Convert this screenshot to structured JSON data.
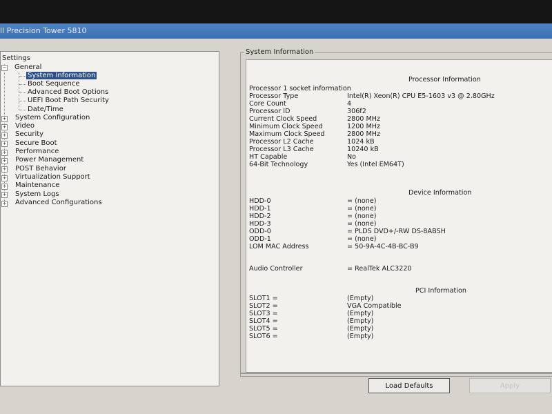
{
  "window": {
    "title": "ll Precision Tower 5810"
  },
  "tree": {
    "root_label": "Settings",
    "general": {
      "label": "General",
      "children": [
        "System Information",
        "Boot Sequence",
        "Advanced Boot Options",
        "UEFI Boot Path Security",
        "Date/Time"
      ]
    },
    "categories": [
      "System Configuration",
      "Video",
      "Security",
      "Secure Boot",
      "Performance",
      "Power Management",
      "POST Behavior",
      "Virtualization Support",
      "Maintenance",
      "System Logs",
      "Advanced Configurations"
    ],
    "expander_collapsed": "+",
    "expander_expanded": "−"
  },
  "info": {
    "group_title": "System Information",
    "processor": {
      "heading": "Processor Information",
      "socket_line": "Processor 1 socket information",
      "rows": [
        {
          "label": "Processor Type",
          "value": "Intel(R) Xeon(R) CPU E5-1603 v3 @ 2.80GHz"
        },
        {
          "label": "Core Count",
          "value": "4"
        },
        {
          "label": "Processor ID",
          "value": "306f2"
        },
        {
          "label": "Current Clock Speed",
          "value": "2800 MHz"
        },
        {
          "label": "Minimum Clock Speed",
          "value": "1200 MHz"
        },
        {
          "label": "Maximum Clock Speed",
          "value": "2800 MHz"
        },
        {
          "label": "Processor L2 Cache",
          "value": "1024 kB"
        },
        {
          "label": "Processor L3 Cache",
          "value": "10240 kB"
        },
        {
          "label": "HT Capable",
          "value": "No"
        },
        {
          "label": "64-Bit Technology",
          "value": "Yes (Intel EM64T)"
        }
      ]
    },
    "device": {
      "heading": "Device Information",
      "rows": [
        {
          "label": "HDD-0",
          "value": "= (none)"
        },
        {
          "label": "HDD-1",
          "value": "= (none)"
        },
        {
          "label": "HDD-2",
          "value": "= (none)"
        },
        {
          "label": "HDD-3",
          "value": "= (none)"
        },
        {
          "label": "ODD-0",
          "value": "= PLDS DVD+/-RW DS-8ABSH"
        },
        {
          "label": "ODD-1",
          "value": "= (none)"
        },
        {
          "label": "LOM MAC Address",
          "value": "= 50-9A-4C-4B-BC-B9"
        }
      ],
      "audio": {
        "label": "Audio Controller",
        "value": "= RealTek ALC3220"
      }
    },
    "pci": {
      "heading": "PCI Information",
      "rows": [
        {
          "label": "SLOT1 =",
          "value": "(Empty)"
        },
        {
          "label": "SLOT2 =",
          "value": "VGA Compatible"
        },
        {
          "label": "SLOT3 =",
          "value": "(Empty)"
        },
        {
          "label": "SLOT4 =",
          "value": "(Empty)"
        },
        {
          "label": "SLOT5 =",
          "value": "(Empty)"
        },
        {
          "label": "SLOT6 =",
          "value": "(Empty)"
        }
      ]
    }
  },
  "buttons": {
    "load_defaults": "Load Defaults",
    "apply": "Apply"
  },
  "colors": {
    "title_bar": "#3a6fb3",
    "selection": "#2d4f8a",
    "panel": "#f2f1ee",
    "background": "#d7d4cd"
  }
}
